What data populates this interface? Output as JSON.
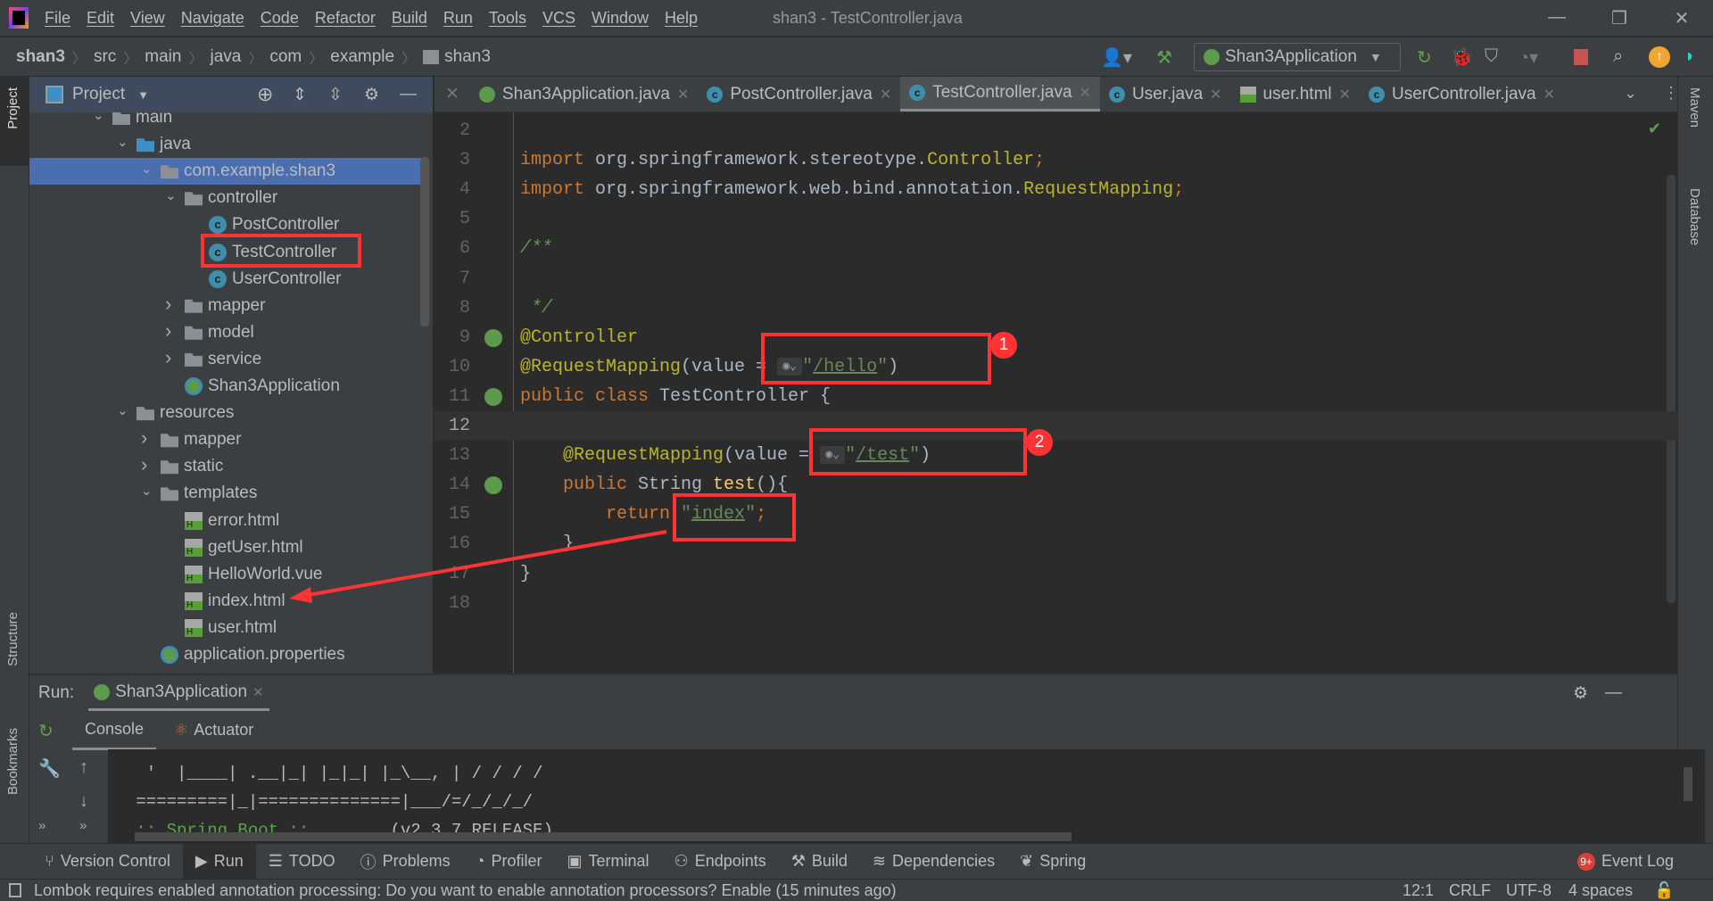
{
  "menu": [
    "File",
    "Edit",
    "View",
    "Navigate",
    "Code",
    "Refactor",
    "Build",
    "Run",
    "Tools",
    "VCS",
    "Window",
    "Help"
  ],
  "window_title": "shan3 - TestController.java",
  "window_controls": {
    "minimize": "—",
    "restore": "❐",
    "close": "✕"
  },
  "breadcrumb": [
    "shan3",
    "src",
    "main",
    "java",
    "com",
    "example",
    "shan3"
  ],
  "run_config": "Shan3Application",
  "colors": {
    "accent_selection": "#4b6eaf",
    "annotation_red": "#ff3333",
    "keyword": "#cc7832",
    "string": "#6a8759",
    "annotation": "#bbb529"
  },
  "left_stripe": {
    "project": "Project",
    "structure": "Structure",
    "bookmarks": "Bookmarks"
  },
  "right_stripe": {
    "maven": "Maven",
    "database": "Database"
  },
  "project_panel": {
    "title": "Project",
    "tree": [
      {
        "label": "main",
        "depth": 0,
        "arrow": "open",
        "icon": "folder"
      },
      {
        "label": "java",
        "depth": 1,
        "arrow": "open",
        "icon": "folder-blue"
      },
      {
        "label": "com.example.shan3",
        "depth": 2,
        "arrow": "open",
        "icon": "package",
        "selected": true
      },
      {
        "label": "controller",
        "depth": 3,
        "arrow": "open",
        "icon": "package"
      },
      {
        "label": "PostController",
        "depth": 4,
        "icon": "class"
      },
      {
        "label": "TestController",
        "depth": 4,
        "icon": "class",
        "highlighted": true
      },
      {
        "label": "UserController",
        "depth": 4,
        "icon": "class"
      },
      {
        "label": "mapper",
        "depth": 3,
        "arrow": "closed",
        "icon": "package"
      },
      {
        "label": "model",
        "depth": 3,
        "arrow": "closed",
        "icon": "package"
      },
      {
        "label": "service",
        "depth": 3,
        "arrow": "closed",
        "icon": "package"
      },
      {
        "label": "Shan3Application",
        "depth": 3,
        "icon": "spring-app"
      },
      {
        "label": "resources",
        "depth": 1,
        "arrow": "open",
        "icon": "folder"
      },
      {
        "label": "mapper",
        "depth": 2,
        "arrow": "closed",
        "icon": "folder"
      },
      {
        "label": "static",
        "depth": 2,
        "arrow": "closed",
        "icon": "folder"
      },
      {
        "label": "templates",
        "depth": 2,
        "arrow": "open",
        "icon": "folder"
      },
      {
        "label": "error.html",
        "depth": 3,
        "icon": "html"
      },
      {
        "label": "getUser.html",
        "depth": 3,
        "icon": "html"
      },
      {
        "label": "HelloWorld.vue",
        "depth": 3,
        "icon": "html"
      },
      {
        "label": "index.html",
        "depth": 3,
        "icon": "html"
      },
      {
        "label": "user.html",
        "depth": 3,
        "icon": "html"
      },
      {
        "label": "application.properties",
        "depth": 2,
        "icon": "spring-properties"
      }
    ]
  },
  "editor_tabs": [
    {
      "label": "Shan3Application.java",
      "icon": "spring-app"
    },
    {
      "label": "PostController.java",
      "icon": "class"
    },
    {
      "label": "TestController.java",
      "icon": "class",
      "active": true
    },
    {
      "label": "User.java",
      "icon": "class"
    },
    {
      "label": "user.html",
      "icon": "html"
    },
    {
      "label": "UserController.java",
      "icon": "class"
    }
  ],
  "code": {
    "current_line": 12,
    "lines": [
      {
        "n": "2",
        "tokens": []
      },
      {
        "n": "3",
        "tokens": [
          {
            "k": "kw",
            "t": "import"
          },
          {
            "k": "plain",
            "t": " org.springframework.stereotype."
          },
          {
            "k": "ann",
            "t": "Controller"
          },
          {
            "k": "kw",
            "t": ";"
          }
        ]
      },
      {
        "n": "4",
        "tokens": [
          {
            "k": "kw",
            "t": "import"
          },
          {
            "k": "plain",
            "t": " org.springframework.web.bind.annotation."
          },
          {
            "k": "ann",
            "t": "RequestMapping"
          },
          {
            "k": "kw",
            "t": ";"
          }
        ]
      },
      {
        "n": "5",
        "tokens": []
      },
      {
        "n": "6",
        "tokens": [
          {
            "k": "com",
            "t": "/**"
          }
        ]
      },
      {
        "n": "7",
        "tokens": []
      },
      {
        "n": "8",
        "tokens": [
          {
            "k": "com",
            "t": " */"
          }
        ]
      },
      {
        "n": "9",
        "gutter": "spring-bean",
        "tokens": [
          {
            "k": "ann",
            "t": "@Controller"
          }
        ]
      },
      {
        "n": "10",
        "tokens": [
          {
            "k": "ann",
            "t": "@RequestMapping"
          },
          {
            "k": "plain",
            "t": "(value = "
          },
          {
            "k": "globe",
            "t": "🌐v"
          },
          {
            "k": "str",
            "t": "\""
          },
          {
            "k": "link",
            "t": "/hello"
          },
          {
            "k": "str",
            "t": "\""
          },
          {
            "k": "plain",
            "t": ")"
          }
        ]
      },
      {
        "n": "11",
        "gutter": "spring-web",
        "tokens": [
          {
            "k": "kw",
            "t": "public class "
          },
          {
            "k": "plain",
            "t": "TestController {"
          }
        ]
      },
      {
        "n": "12",
        "tokens": []
      },
      {
        "n": "13",
        "tokens": [
          {
            "k": "plain",
            "t": "    "
          },
          {
            "k": "ann",
            "t": "@RequestMapping"
          },
          {
            "k": "plain",
            "t": "(value = "
          },
          {
            "k": "globe",
            "t": "🌐v"
          },
          {
            "k": "str",
            "t": "\""
          },
          {
            "k": "link",
            "t": "/test"
          },
          {
            "k": "str",
            "t": "\""
          },
          {
            "k": "plain",
            "t": ")"
          }
        ]
      },
      {
        "n": "14",
        "gutter": "spring-web",
        "tokens": [
          {
            "k": "plain",
            "t": "    "
          },
          {
            "k": "kw",
            "t": "public "
          },
          {
            "k": "plain",
            "t": "String "
          },
          {
            "k": "fn",
            "t": "test"
          },
          {
            "k": "plain",
            "t": "(){"
          }
        ]
      },
      {
        "n": "15",
        "tokens": [
          {
            "k": "plain",
            "t": "        "
          },
          {
            "k": "kw",
            "t": "return "
          },
          {
            "k": "str",
            "t": "\""
          },
          {
            "k": "link",
            "t": "index"
          },
          {
            "k": "str",
            "t": "\""
          },
          {
            "k": "kw",
            "t": ";"
          }
        ]
      },
      {
        "n": "16",
        "tokens": [
          {
            "k": "plain",
            "t": "    }"
          }
        ]
      },
      {
        "n": "17",
        "tokens": [
          {
            "k": "plain",
            "t": "}"
          }
        ]
      },
      {
        "n": "18",
        "tokens": []
      }
    ]
  },
  "annotations": {
    "badge1": "1",
    "badge2": "2"
  },
  "run_panel": {
    "label": "Run:",
    "tab": "Shan3Application",
    "subtabs": [
      "Console",
      "Actuator"
    ],
    "console_lines": [
      "  '  |____| .__|_| |_|_| |_\\__, | / / / /",
      " =========|_|==============|___/=/_/_/_/"
    ],
    "spring_boot_label": " :: Spring Boot :: ",
    "spring_boot_version": "       (v2.3.7.RELEASE)"
  },
  "bottom_tools": [
    "Version Control",
    "Run",
    "TODO",
    "Problems",
    "Profiler",
    "Terminal",
    "Endpoints",
    "Build",
    "Dependencies",
    "Spring"
  ],
  "bottom_tools_active": "Run",
  "event_log": {
    "label": "Event Log",
    "badge": "9+"
  },
  "status": {
    "message": "Lombok requires enabled annotation processing: Do you want to enable annotation processors? Enable (15 minutes ago)",
    "position": "12:1",
    "line_sep": "CRLF",
    "encoding": "UTF-8",
    "indent": "4 spaces"
  }
}
